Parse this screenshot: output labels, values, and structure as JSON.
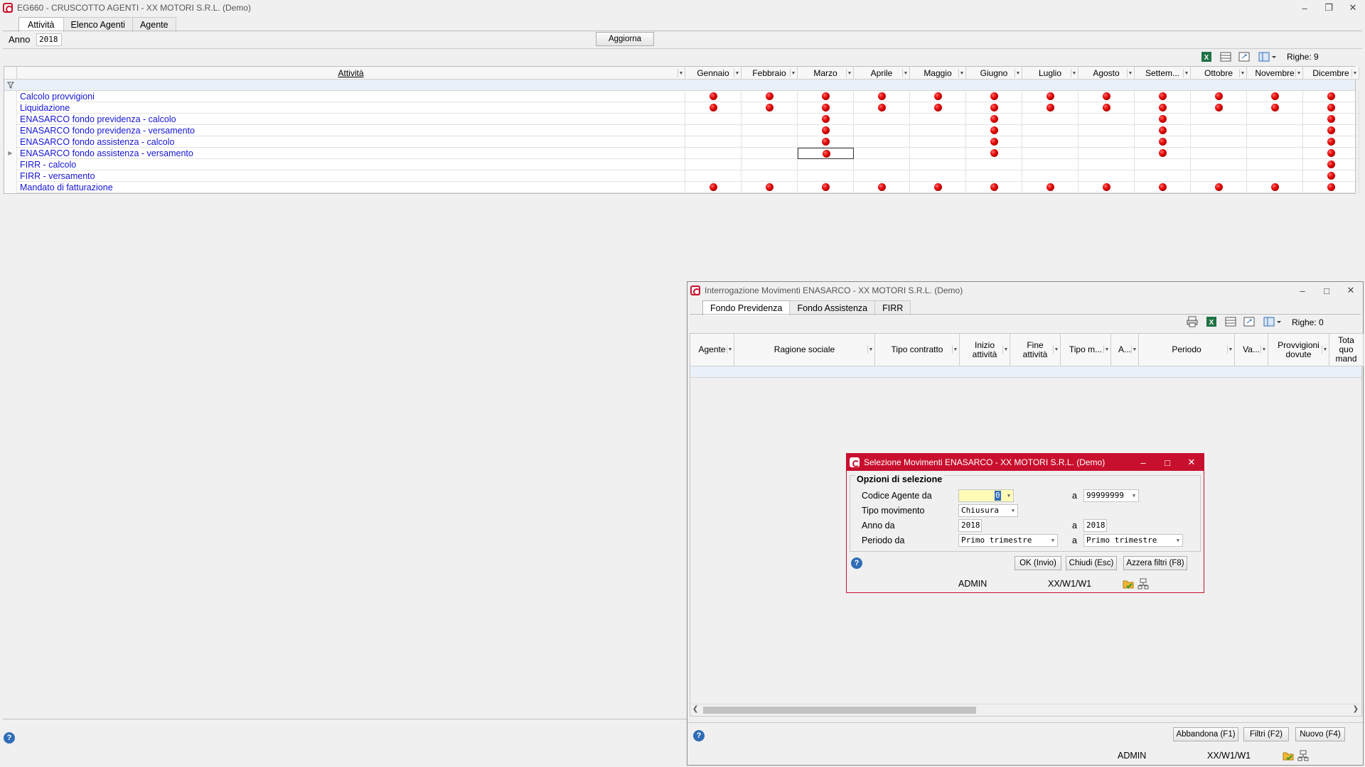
{
  "main": {
    "title": "EG660 - CRUSCOTTO AGENTI - XX  MOTORI S.R.L.  (Demo)",
    "tabs": [
      "Attività",
      "Elenco Agenti",
      "Agente"
    ],
    "anno_label": "Anno",
    "anno_value": "2018",
    "aggiorna": "Aggiorna",
    "righe": "Righe: 9",
    "col_attivita": "Attività",
    "months": [
      "Gennaio",
      "Febbraio",
      "Marzo",
      "Aprile",
      "Maggio",
      "Giugno",
      "Luglio",
      "Agosto",
      "Settem...",
      "Ottobre",
      "Novembre",
      "Dicembre"
    ],
    "rows": [
      {
        "label": "Calcolo provvigioni",
        "marks": [
          1,
          1,
          1,
          1,
          1,
          1,
          1,
          1,
          1,
          1,
          1,
          1
        ]
      },
      {
        "label": "Liquidazione",
        "marks": [
          1,
          1,
          1,
          1,
          1,
          1,
          1,
          1,
          1,
          1,
          1,
          1
        ]
      },
      {
        "label": "ENASARCO fondo previdenza - calcolo",
        "marks": [
          0,
          0,
          1,
          0,
          0,
          1,
          0,
          0,
          1,
          0,
          0,
          1
        ]
      },
      {
        "label": "ENASARCO fondo previdenza - versamento",
        "marks": [
          0,
          0,
          1,
          0,
          0,
          1,
          0,
          0,
          1,
          0,
          0,
          1
        ]
      },
      {
        "label": "ENASARCO fondo assistenza - calcolo",
        "marks": [
          0,
          0,
          1,
          0,
          0,
          1,
          0,
          0,
          1,
          0,
          0,
          1
        ]
      },
      {
        "label": "ENASARCO fondo assistenza - versamento",
        "marks": [
          0,
          0,
          1,
          0,
          0,
          1,
          0,
          0,
          1,
          0,
          0,
          1
        ]
      },
      {
        "label": "FIRR - calcolo",
        "marks": [
          0,
          0,
          0,
          0,
          0,
          0,
          0,
          0,
          0,
          0,
          0,
          1
        ]
      },
      {
        "label": "FIRR - versamento",
        "marks": [
          0,
          0,
          0,
          0,
          0,
          0,
          0,
          0,
          0,
          0,
          0,
          1
        ]
      },
      {
        "label": "Mandato di fatturazione",
        "marks": [
          1,
          1,
          1,
          1,
          1,
          1,
          1,
          1,
          1,
          1,
          1,
          1
        ]
      }
    ]
  },
  "interrog": {
    "title": "Interrogazione Movimenti ENASARCO - XX  MOTORI S.R.L.  (Demo)",
    "tabs": [
      "Fondo Previdenza",
      "Fondo Assistenza",
      "FIRR"
    ],
    "righe": "Righe: 0",
    "columns": [
      "Agente",
      "Ragione sociale",
      "Tipo contratto",
      "Inizio\nattività",
      "Fine\nattività",
      "Tipo m...",
      "A...",
      "Periodo",
      "Va...",
      "Provvigioni\ndovute",
      "Tota\nquo\nmand"
    ],
    "buttons": [
      "Abbandona (F1)",
      "Filtri (F2)",
      "Nuovo (F4)"
    ],
    "status_user": "ADMIN",
    "status_path": "XX/W1/W1"
  },
  "dialog": {
    "title": "Selezione Movimenti ENASARCO - XX  MOTORI S.R.L.  (Demo)",
    "group": "Opzioni di selezione",
    "codice_label": "Codice Agente da",
    "codice_from": "0",
    "codice_to": "99999999",
    "a": "a",
    "tipo_label": "Tipo movimento",
    "tipo_value": "Chiusura",
    "anno_label": "Anno da",
    "anno_from": "2018",
    "anno_to": "2018",
    "periodo_label": "Periodo da",
    "periodo_from": "Primo trimestre",
    "periodo_to": "Primo trimestre",
    "buttons": [
      "OK (Invio)",
      "Chiudi (Esc)",
      "Azzera filtri (F8)"
    ],
    "status_user": "ADMIN",
    "status_path": "XX/W1/W1"
  },
  "colors": {
    "accent_red": "#c8102e",
    "link_blue": "#1616d6",
    "dot_red": "#e00000"
  }
}
